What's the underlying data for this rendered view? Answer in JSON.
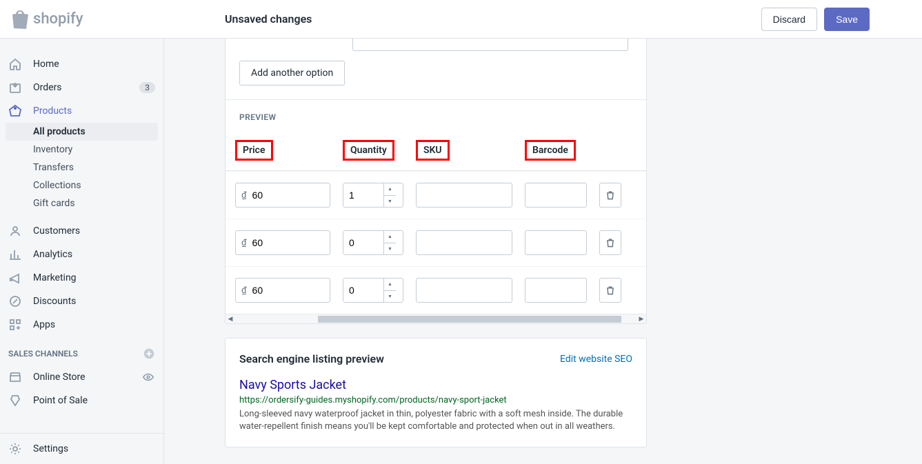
{
  "topbar": {
    "logo_text": "shopify",
    "title": "Unsaved changes",
    "discard": "Discard",
    "save": "Save"
  },
  "sidebar": {
    "home": "Home",
    "orders": "Orders",
    "orders_badge": "3",
    "products": "Products",
    "products_sub": {
      "all": "All products",
      "inventory": "Inventory",
      "transfers": "Transfers",
      "collections": "Collections",
      "gift_cards": "Gift cards"
    },
    "customers": "Customers",
    "analytics": "Analytics",
    "marketing": "Marketing",
    "discounts": "Discounts",
    "apps": "Apps",
    "sales_channels": "SALES CHANNELS",
    "online_store": "Online Store",
    "point_of_sale": "Point of Sale",
    "settings": "Settings"
  },
  "variants": {
    "add_option": "Add another option",
    "preview_label": "PREVIEW",
    "headers": {
      "price": "Price",
      "quantity": "Quantity",
      "sku": "SKU",
      "barcode": "Barcode"
    },
    "currency": "₫",
    "rows": [
      {
        "price": "60",
        "qty": "1",
        "sku": "",
        "barcode": ""
      },
      {
        "price": "60",
        "qty": "0",
        "sku": "",
        "barcode": ""
      },
      {
        "price": "60",
        "qty": "0",
        "sku": "",
        "barcode": ""
      }
    ]
  },
  "seo": {
    "heading": "Search engine listing preview",
    "edit_link": "Edit website SEO",
    "title": "Navy Sports Jacket",
    "url": "https://ordersify-guides.myshopify.com/products/navy-sport-jacket",
    "description": "Long-sleeved navy waterproof jacket in thin, polyester fabric with a soft mesh inside. The durable water-repellent finish means you'll be kept comfortable and protected when out in all weathers."
  }
}
